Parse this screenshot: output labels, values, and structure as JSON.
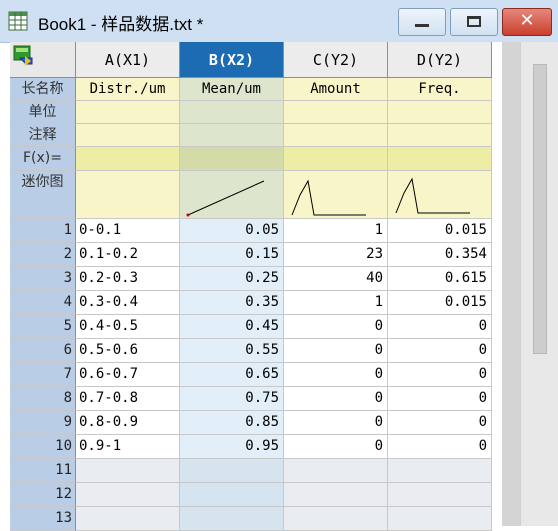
{
  "window": {
    "title": "Book1 - 样品数据.txt *",
    "close_glyph": "✕",
    "icon": "spreadsheet-icon"
  },
  "sheet": {
    "toolbar_icon": "book-icon",
    "columns": [
      {
        "header": "A(X1)",
        "long_name": "Distr./um",
        "selected": false
      },
      {
        "header": "B(X2)",
        "long_name": "Mean/um",
        "selected": true
      },
      {
        "header": "C(Y2)",
        "long_name": "Amount",
        "selected": false
      },
      {
        "header": "D(Y2)",
        "long_name": "Freq.",
        "selected": false
      }
    ],
    "row_labels": {
      "long_name": "长名称",
      "units": "单位",
      "comments": "注释",
      "fx": "F(x)=",
      "sparkline": "迷你图"
    },
    "rows": [
      {
        "num": "1",
        "a": "0-0.1",
        "b": "0.05",
        "c": "1",
        "d": "0.015"
      },
      {
        "num": "2",
        "a": "0.1-0.2",
        "b": "0.15",
        "c": "23",
        "d": "0.354"
      },
      {
        "num": "3",
        "a": "0.2-0.3",
        "b": "0.25",
        "c": "40",
        "d": "0.615"
      },
      {
        "num": "4",
        "a": "0.3-0.4",
        "b": "0.35",
        "c": "1",
        "d": "0.015"
      },
      {
        "num": "5",
        "a": "0.4-0.5",
        "b": "0.45",
        "c": "0",
        "d": "0"
      },
      {
        "num": "6",
        "a": "0.5-0.6",
        "b": "0.55",
        "c": "0",
        "d": "0"
      },
      {
        "num": "7",
        "a": "0.6-0.7",
        "b": "0.65",
        "c": "0",
        "d": "0"
      },
      {
        "num": "8",
        "a": "0.7-0.8",
        "b": "0.75",
        "c": "0",
        "d": "0"
      },
      {
        "num": "9",
        "a": "0.8-0.9",
        "b": "0.85",
        "c": "0",
        "d": "0"
      },
      {
        "num": "10",
        "a": "0.9-1",
        "b": "0.95",
        "c": "0",
        "d": "0"
      }
    ],
    "empty_rows": [
      "11",
      "12",
      "13"
    ]
  },
  "colors": {
    "selected_header": "#1d6cb3",
    "row_header": "#b9cee6",
    "label_area": "#f8f6c9"
  }
}
